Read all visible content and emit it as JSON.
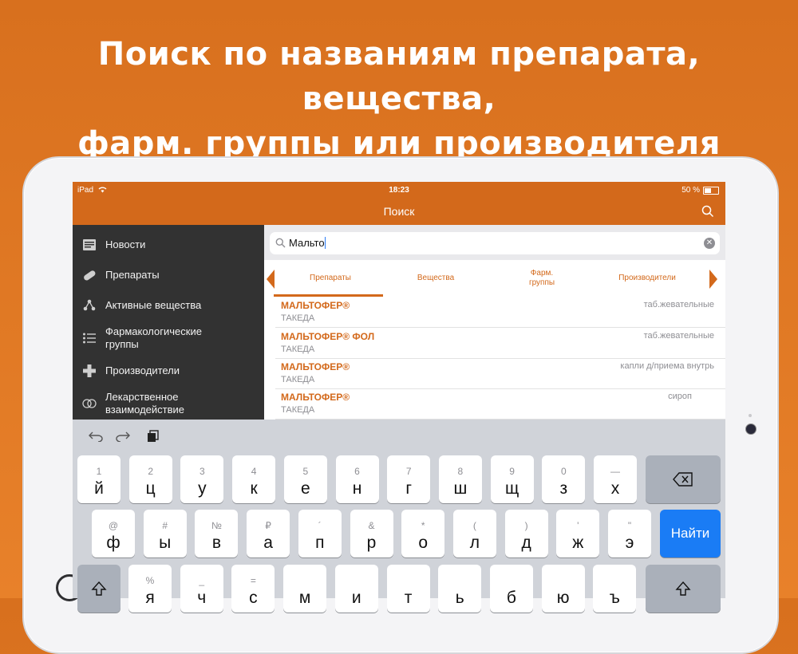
{
  "headline": {
    "line1": "Поиск по названиям препарата, вещества,",
    "line2": "фарм. группы или производителя"
  },
  "statusbar": {
    "device": "iPad",
    "time": "18:23",
    "battery": "50 %",
    "battery_level": 0.5
  },
  "navbar": {
    "title": "Поиск"
  },
  "sidebar": {
    "items": [
      {
        "label": "Новости",
        "icon": "news-icon"
      },
      {
        "label": "Препараты",
        "icon": "pill-icon"
      },
      {
        "label": "Активные вещества",
        "icon": "molecule-icon"
      },
      {
        "label": "Фармакологические группы",
        "icon": "list-icon"
      },
      {
        "label": "Производители",
        "icon": "plus-icon"
      },
      {
        "label": "Лекарственное взаимодействие",
        "icon": "interaction-icon"
      }
    ]
  },
  "search": {
    "value": "Мальто"
  },
  "tabs": [
    "Препараты",
    "Вещества",
    "Фарм.\nгруппы",
    "Производители"
  ],
  "results": [
    {
      "name": "МАЛЬТОФЕР®",
      "manufacturer": "ТАКЕДА",
      "form": "таб.жевательные"
    },
    {
      "name": "МАЛЬТОФЕР® ФОЛ",
      "manufacturer": "ТАКЕДА",
      "form": "таб.жевательные"
    },
    {
      "name": "МАЛЬТОФЕР®",
      "manufacturer": "ТАКЕДА",
      "form": "капли д/приема внутрь"
    },
    {
      "name": "МАЛЬТОФЕР®",
      "manufacturer": "ТАКЕДА",
      "form": "сироп"
    }
  ],
  "keyboard": {
    "row1": [
      {
        "s": "1",
        "p": "й"
      },
      {
        "s": "2",
        "p": "ц"
      },
      {
        "s": "3",
        "p": "у"
      },
      {
        "s": "4",
        "p": "к"
      },
      {
        "s": "5",
        "p": "е"
      },
      {
        "s": "6",
        "p": "н"
      },
      {
        "s": "7",
        "p": "г"
      },
      {
        "s": "8",
        "p": "ш"
      },
      {
        "s": "9",
        "p": "щ"
      },
      {
        "s": "0",
        "p": "з"
      },
      {
        "s": "—",
        "p": "х"
      }
    ],
    "row2": [
      {
        "s": "@",
        "p": "ф"
      },
      {
        "s": "#",
        "p": "ы"
      },
      {
        "s": "№",
        "p": "в"
      },
      {
        "s": "₽",
        "p": "а"
      },
      {
        "s": "´",
        "p": "п"
      },
      {
        "s": "&",
        "p": "р"
      },
      {
        "s": "*",
        "p": "о"
      },
      {
        "s": "(",
        "p": "л"
      },
      {
        "s": ")",
        "p": "д"
      },
      {
        "s": "'",
        "p": "ж"
      },
      {
        "s": "\"",
        "p": "э"
      }
    ],
    "row3": [
      {
        "s": "%",
        "p": "я"
      },
      {
        "s": "_",
        "p": "ч"
      },
      {
        "s": "=",
        "p": "с"
      },
      {
        "s": "",
        "p": "м"
      },
      {
        "s": "",
        "p": "и"
      },
      {
        "s": "",
        "p": "т"
      },
      {
        "s": "",
        "p": "ь"
      },
      {
        "s": "",
        "p": "б"
      },
      {
        "s": "",
        "p": "ю"
      },
      {
        "s": "",
        "p": "ъ"
      }
    ],
    "go_label": "Найти"
  },
  "colors": {
    "accent": "#d3691b",
    "sidebar": "#323232",
    "go": "#1a7cf5"
  }
}
